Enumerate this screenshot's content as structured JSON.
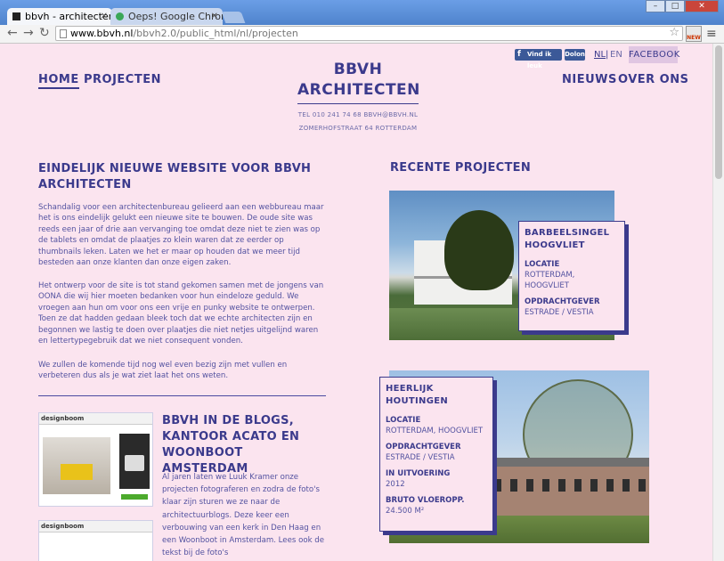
{
  "browser": {
    "tabs": [
      {
        "title": "bbvh - architecten - |"
      },
      {
        "title": "Oeps! Google Chrom"
      }
    ],
    "url_host": "www.bbvh.nl",
    "url_path": "/bbvh2.0/public_html/nl/projecten",
    "ext_label": "NEW"
  },
  "social": {
    "fb_like": "Vind ik leuk",
    "fb_share": "Dolon",
    "lang_nl": "NL",
    "lang_sep": "|",
    "lang_en": "EN",
    "facebook": "FACEBOOK"
  },
  "nav": {
    "home": "HOME",
    "projects": "PROJECTEN",
    "news": "NIEUWS",
    "about": "OVER ONS"
  },
  "logo": {
    "line1": "BBVH",
    "line2": "ARCHITECTEN"
  },
  "contact": {
    "line1": "TEL 010 241 74 68 BBVH@BBVH.NL",
    "line2": "ZOMERHOFSTRAAT 64 ROTTERDAM"
  },
  "article": {
    "title": "EINDELIJK NIEUWE WEBSITE VOOR BBVH ARCHITECTEN",
    "p1": "Schandalig voor een architectenbureau gelieerd aan een webbureau maar het is ons eindelijk gelukt een nieuwe site te bouwen. De oude site was reeds een jaar of drie aan vervanging toe omdat deze niet te zien was op de tablets en omdat de plaatjes zo klein waren dat ze eerder op thumbnails leken. Laten we het er maar op houden dat we meer tijd besteden aan onze klanten dan onze eigen zaken.",
    "p2": "Het ontwerp voor de site is tot stand gekomen samen met de jongens van OONA die wij hier moeten bedanken voor hun eindeloze geduld. We vroegen aan hun om voor ons een vrije en punky website te ontwerpen. Toen ze dat hadden gedaan bleek toch dat we echte architecten zijn en begonnen we lastig te doen over plaatjes die niet netjes uitgelijnd waren en lettertypegebruik dat we niet consequent vonden.",
    "p3": "We zullen de komende tijd nog wel even bezig zijn met vullen en verbeteren dus als je wat ziet laat het ons weten."
  },
  "blog": {
    "thumb_label": "designboom",
    "title": "BBVH IN DE BLOGS, KANTOOR ACATO EN WOONBOOT AMSTERDAM",
    "text": "Al jaren laten we Luuk Kramer onze projecten fotograferen en zodra de foto's klaar zijn sturen we ze naar de architectuurblogs. Deze keer een verbouwing van een kerk in Den Haag en een Woonboot in Amsterdam. Lees ook de tekst bij de foto's"
  },
  "recent": {
    "title": "RECENTE PROJECTEN",
    "projects": [
      {
        "name": "BARBEELSINGEL HOOGVLIET",
        "fields": [
          {
            "label": "LOCATIE",
            "value": "ROTTERDAM, HOOGVLIET"
          },
          {
            "label": "OPDRACHTGEVER",
            "value": "ESTRADE / VESTIA"
          }
        ]
      },
      {
        "name": "HEERLIJK HOUTINGEN",
        "fields": [
          {
            "label": "LOCATIE",
            "value": "ROTTERDAM, HOOGVLIET"
          },
          {
            "label": "OPDRACHTGEVER",
            "value": "ESTRADE / VESTIA"
          },
          {
            "label": "IN UITVOERING",
            "value": "2012"
          },
          {
            "label": "BRUTO VLOEROPP.",
            "value": "24.500 M²"
          }
        ]
      }
    ]
  },
  "colors": {
    "page_bg": "#fbe4ef",
    "brand": "#3b3a8c",
    "chrome": "#5b8fd6"
  }
}
